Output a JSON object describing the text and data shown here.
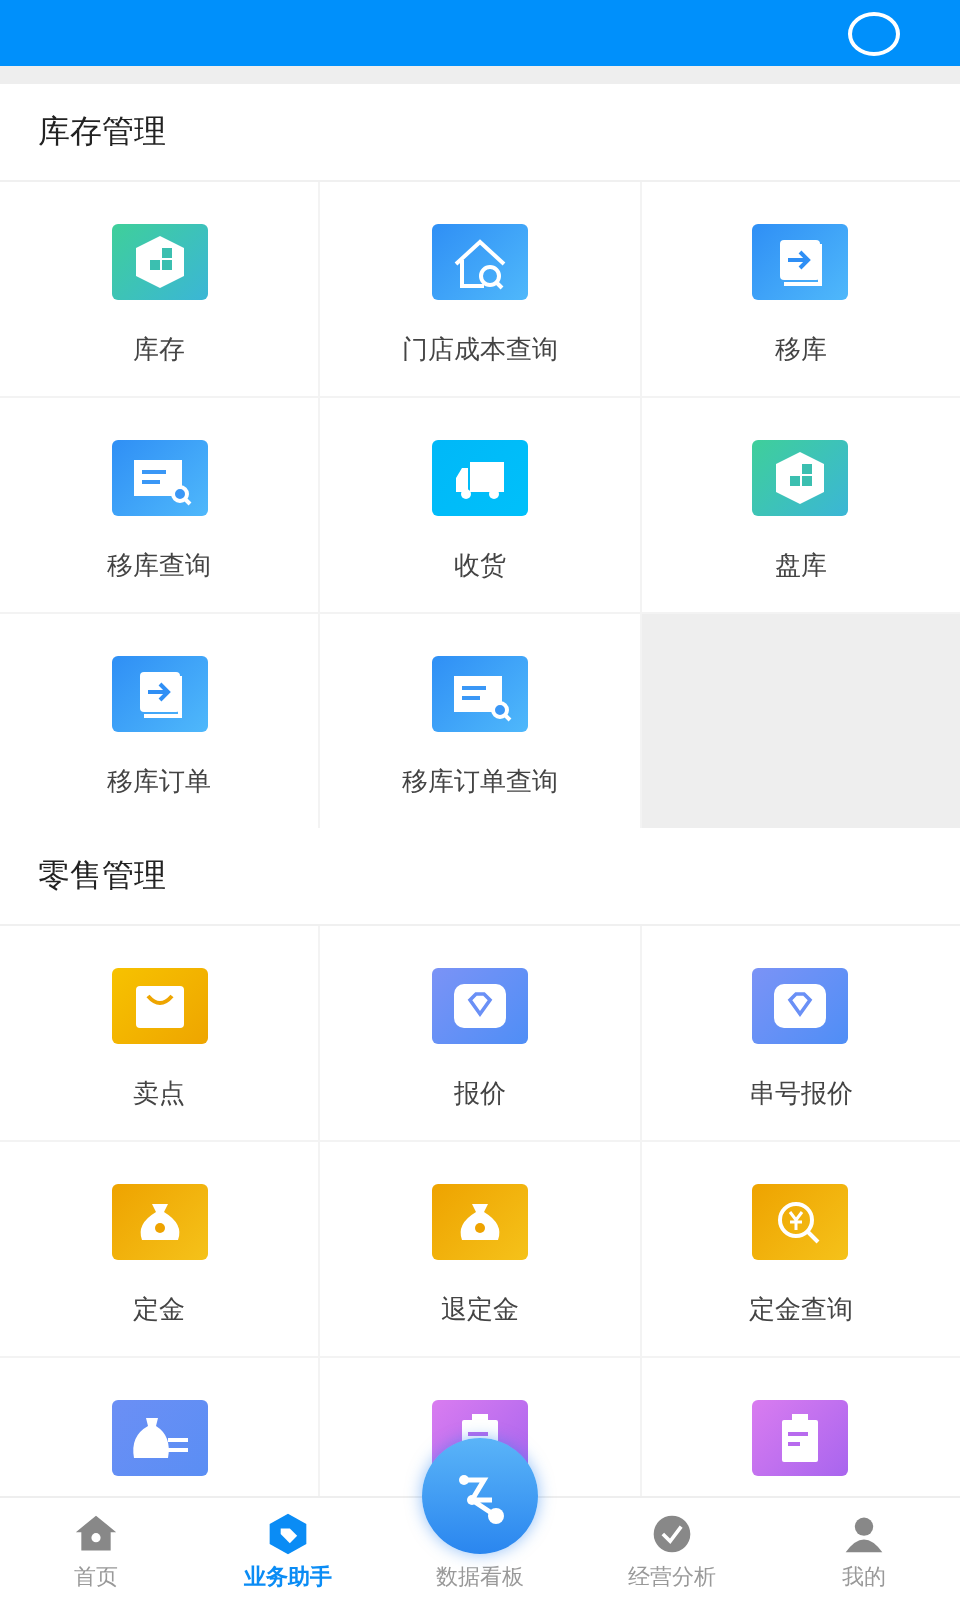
{
  "sections": [
    {
      "title": "库存管理",
      "items": [
        {
          "label": "库存",
          "kind": "hex-box"
        },
        {
          "label": "门店成本查询",
          "kind": "house-search"
        },
        {
          "label": "移库",
          "kind": "arrow-box"
        },
        {
          "label": "移库查询",
          "kind": "doc-search"
        },
        {
          "label": "收货",
          "kind": "truck"
        },
        {
          "label": "盘库",
          "kind": "hex-box"
        },
        {
          "label": "移库订单",
          "kind": "arrow-box"
        },
        {
          "label": "移库订单查询",
          "kind": "doc-search"
        }
      ]
    },
    {
      "title": "零售管理",
      "items": [
        {
          "label": "卖点",
          "kind": "bag"
        },
        {
          "label": "报价",
          "kind": "diamond"
        },
        {
          "label": "串号报价",
          "kind": "diamond"
        },
        {
          "label": "定金",
          "kind": "money-bag"
        },
        {
          "label": "退定金",
          "kind": "money-bag"
        },
        {
          "label": "定金查询",
          "kind": "yen-search"
        },
        {
          "kind": "money-transfer"
        },
        {
          "kind": "clipboard"
        },
        {
          "kind": "clipboard"
        }
      ]
    }
  ],
  "nav": [
    {
      "label": "首页",
      "kind": "home",
      "selected": false
    },
    {
      "label": "业务助手",
      "kind": "tag",
      "selected": true
    },
    {
      "label": "数据看板",
      "kind": "flow",
      "selected": false
    },
    {
      "label": "经营分析",
      "kind": "check",
      "selected": false
    },
    {
      "label": "我的",
      "kind": "person",
      "selected": false
    }
  ]
}
